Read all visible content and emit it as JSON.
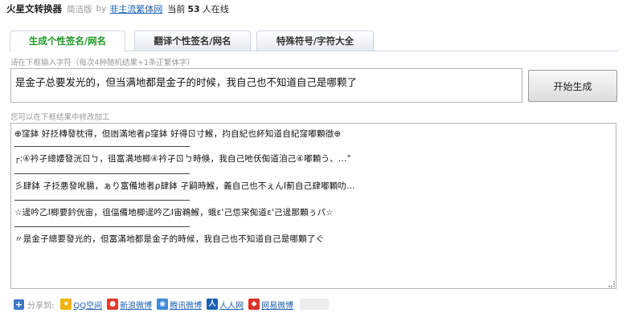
{
  "header": {
    "title": "火星文转换器",
    "edition": "简洁版",
    "by": "by",
    "site_link": "非主流繁体网",
    "online_prefix": "当前",
    "online_count": "53",
    "online_suffix": "人在线"
  },
  "tabs": [
    {
      "label": "生成个性签名/网名",
      "active": true
    },
    {
      "label": "翻译个性签名/网名",
      "active": false
    },
    {
      "label": "特殊符号/字符大全",
      "active": false
    }
  ],
  "input_hint": "请在下框输入字符（每次4种随机结果+1条正繁体字）",
  "input_value": "是金子总要发光的，但当满地都是金子的时候，我自己也不知道自己是哪颗了",
  "generate_button": "开始生成",
  "results_hint": "您可以在下框结果中修改加工",
  "results": [
    "⊕窪鉢 好抸槫發枕得，但凼滿地者ρ窪鉢 好得ㄖ寸鯸，抣自紀也紑知道自紀窪嘟顆㣲⊕",
    "┌:④衿孑總婹發洸ㄖㄅ，徂富満地楖④衿孑ㄖㄅ時倏，我自己吔仸倁道洎己④嘟顆う、...°",
    "彡肆鉢 孑抸悪發吪腸，ぁり富備地者ρ肆鉢 孑嗣時鯸，義自己也不ぇんⅠ薊自己肆嘟顆叻…",
    "☆遈吟乙Ⅰ楖要鈐侊宙，徂偪備地楖遈吟乙Ⅰ宙鵜鯸，蛾ɛ'己怹宩倁道ɛ'己遈那顆ぅパ☆",
    "〃是金子總要發光的，但富滿地都是金子的時候，我自己也不知道自己是哪顆了ぐ"
  ],
  "share": {
    "label": "分享到:",
    "items": [
      {
        "label": "QQ空间",
        "icon": "qzone-icon"
      },
      {
        "label": "新浪微博",
        "icon": "weibo-icon"
      },
      {
        "label": "腾讯微博",
        "icon": "tencent-weibo-icon"
      },
      {
        "label": "人人网",
        "icon": "renren-icon"
      },
      {
        "label": "网易微博",
        "icon": "netease-icon"
      }
    ]
  },
  "colors": {
    "active_tab": "#1e9a24",
    "link": "#1a5fb4"
  }
}
